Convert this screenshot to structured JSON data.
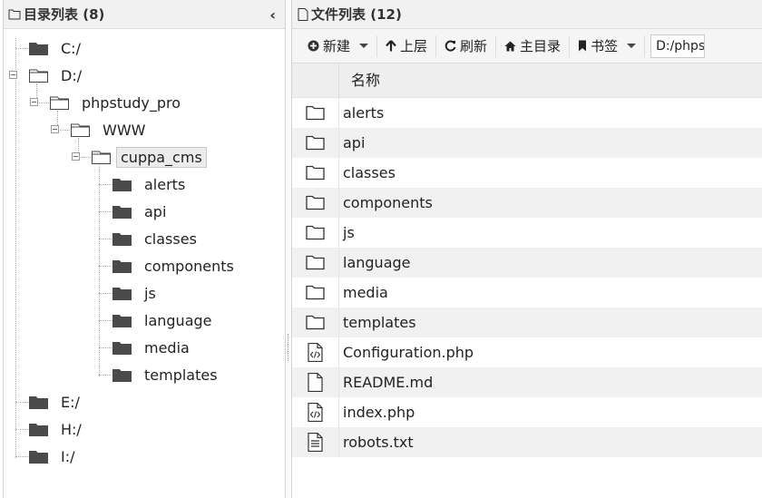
{
  "tree_panel": {
    "title": "目录列表 (8)",
    "collapse_icon": "chevron-left-icon",
    "nodes": {
      "c": "C:/",
      "d": "D:/",
      "phpstudy": "phpstudy_pro",
      "www": "WWW",
      "cuppa": "cuppa_cms",
      "children": [
        "alerts",
        "api",
        "classes",
        "components",
        "js",
        "language",
        "media",
        "templates"
      ],
      "e": "E:/",
      "h": "H:/",
      "i": "I:/"
    }
  },
  "file_panel": {
    "title": "文件列表 (12)",
    "toolbar": {
      "new": "新建",
      "up": "上层",
      "refresh": "刷新",
      "home": "主目录",
      "bookmark": "书签",
      "path": "D:/phpstudy_pro/WWW/cuppa_cms"
    },
    "column_name": "名称",
    "files": [
      {
        "name": "alerts",
        "icon": "folder-icon"
      },
      {
        "name": "api",
        "icon": "folder-icon"
      },
      {
        "name": "classes",
        "icon": "folder-icon"
      },
      {
        "name": "components",
        "icon": "folder-icon"
      },
      {
        "name": "js",
        "icon": "folder-icon"
      },
      {
        "name": "language",
        "icon": "folder-icon"
      },
      {
        "name": "media",
        "icon": "folder-icon"
      },
      {
        "name": "templates",
        "icon": "folder-icon"
      },
      {
        "name": "Configuration.php",
        "icon": "code-file-icon"
      },
      {
        "name": "README.md",
        "icon": "file-icon"
      },
      {
        "name": "index.php",
        "icon": "code-file-icon"
      },
      {
        "name": "robots.txt",
        "icon": "text-file-icon"
      }
    ]
  }
}
